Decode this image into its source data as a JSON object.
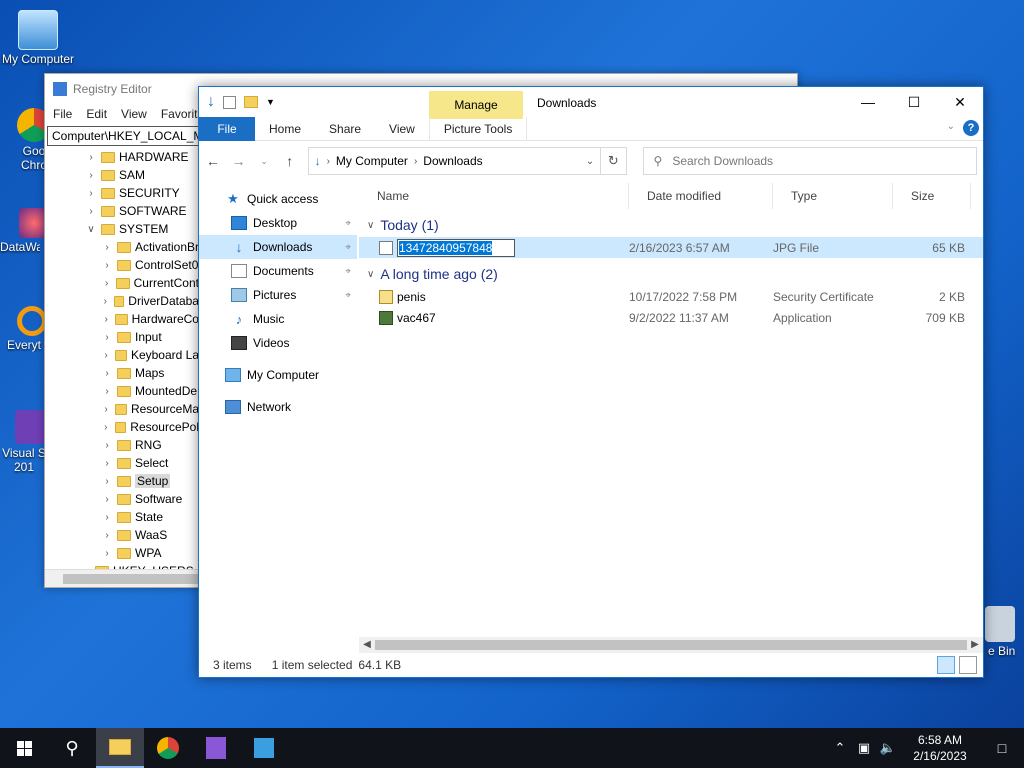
{
  "desktop": {
    "icons": [
      {
        "label": "My Computer",
        "name": "my-computer"
      },
      {
        "label": "Goo Chro",
        "name": "google-chrome"
      },
      {
        "label": "DataWa",
        "name": "datawa"
      },
      {
        "label": "Everyt",
        "name": "everything"
      },
      {
        "label": "Visual S 201",
        "name": "visual-studio"
      },
      {
        "label": "e Bin",
        "name": "recycle-bin"
      }
    ]
  },
  "regedit": {
    "title": "Registry Editor",
    "menu": [
      "File",
      "Edit",
      "View",
      "Favorite"
    ],
    "address": "Computer\\HKEY_LOCAL_MA",
    "tree": [
      {
        "label": "HARDWARE",
        "level": 1
      },
      {
        "label": "SAM",
        "level": 1
      },
      {
        "label": "SECURITY",
        "level": 1
      },
      {
        "label": "SOFTWARE",
        "level": 1
      },
      {
        "label": "SYSTEM",
        "level": 1,
        "expanded": true
      },
      {
        "label": "ActivationBr",
        "level": 2
      },
      {
        "label": "ControlSet0",
        "level": 2
      },
      {
        "label": "CurrentCont",
        "level": 2
      },
      {
        "label": "DriverDataba",
        "level": 2
      },
      {
        "label": "HardwareCo",
        "level": 2
      },
      {
        "label": "Input",
        "level": 2
      },
      {
        "label": "Keyboard La",
        "level": 2
      },
      {
        "label": "Maps",
        "level": 2
      },
      {
        "label": "MountedDe",
        "level": 2
      },
      {
        "label": "ResourceMa",
        "level": 2
      },
      {
        "label": "ResourcePol",
        "level": 2
      },
      {
        "label": "RNG",
        "level": 2
      },
      {
        "label": "Select",
        "level": 2
      },
      {
        "label": "Setup",
        "level": 2,
        "selected": true
      },
      {
        "label": "Software",
        "level": 2
      },
      {
        "label": "State",
        "level": 2
      },
      {
        "label": "WaaS",
        "level": 2
      },
      {
        "label": "WPA",
        "level": 2
      },
      {
        "label": "HKEY_USERS",
        "level": 0
      }
    ]
  },
  "explorer": {
    "title": "Downloads",
    "manage_tab": "Manage",
    "ribbon_tabs": [
      "File",
      "Home",
      "Share",
      "View",
      "Picture Tools"
    ],
    "address": {
      "root": "My Computer",
      "folder": "Downloads"
    },
    "search_placeholder": "Search Downloads",
    "nav": [
      {
        "label": "Quick access",
        "sub": false,
        "icon": "star-icon"
      },
      {
        "label": "Desktop",
        "sub": true,
        "pin": true,
        "icon": "desktop-icon"
      },
      {
        "label": "Downloads",
        "sub": true,
        "pin": true,
        "selected": true,
        "icon": "download-arrow-icon"
      },
      {
        "label": "Documents",
        "sub": true,
        "pin": true,
        "icon": "document-icon"
      },
      {
        "label": "Pictures",
        "sub": true,
        "pin": true,
        "icon": "picture-icon"
      },
      {
        "label": "Music",
        "sub": true,
        "icon": "music-note-icon"
      },
      {
        "label": "Videos",
        "sub": true,
        "icon": "video-icon"
      },
      {
        "label": "My Computer",
        "sub": false,
        "icon": "computer-icon"
      },
      {
        "label": "Network",
        "sub": false,
        "icon": "network-icon"
      }
    ],
    "columns": [
      "Name",
      "Date modified",
      "Type",
      "Size"
    ],
    "groups": [
      {
        "label": "Today (1)",
        "files": [
          {
            "name": "13472840957848",
            "date": "2/16/2023 6:57 AM",
            "type": "JPG File",
            "size": "65 KB",
            "kind": "jpg",
            "selected": true,
            "renaming": true
          }
        ]
      },
      {
        "label": "A long time ago (2)",
        "files": [
          {
            "name": "penis",
            "date": "10/17/2022 7:58 PM",
            "type": "Security Certificate",
            "size": "2 KB",
            "kind": "cert"
          },
          {
            "name": "vac467",
            "date": "9/2/2022 11:37 AM",
            "type": "Application",
            "size": "709 KB",
            "kind": "app"
          }
        ]
      }
    ],
    "status": {
      "items": "3 items",
      "selected": "1 item selected",
      "size": "64.1 KB"
    }
  },
  "taskbar": {
    "time": "6:58 AM",
    "date": "2/16/2023"
  },
  "colors": {
    "accent": "#1a6ec4",
    "selection": "#cce8ff",
    "manage": "#f5e78a"
  }
}
